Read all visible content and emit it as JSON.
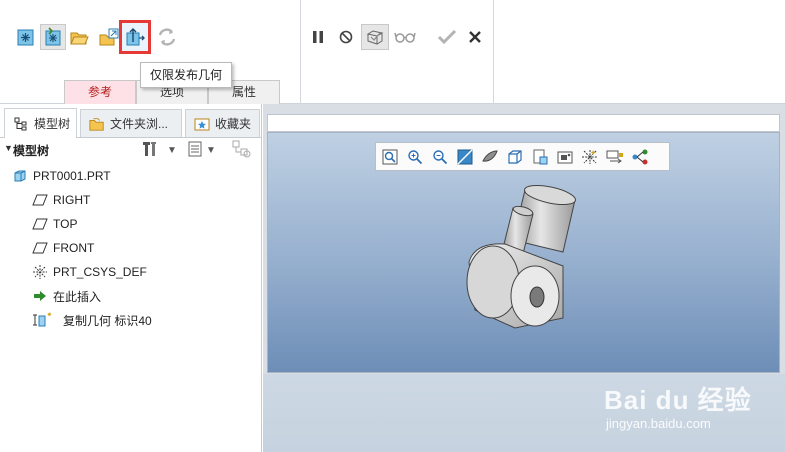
{
  "dashboard": {
    "tooltip": "仅限发布几何",
    "tabs": [
      {
        "label": "参考",
        "active": true
      },
      {
        "label": "选项",
        "active": false
      },
      {
        "label": "属性",
        "active": false
      }
    ],
    "icons": {
      "group1": [
        "csys-icon",
        "import-csys-icon",
        "open-folder-icon",
        "external-ref-icon",
        "publish-geometry-only-icon",
        "update-icon"
      ],
      "group2": [
        "pause-icon",
        "no-preview-icon",
        "verify-icon",
        "glasses-icon",
        "ok-check-icon",
        "cancel-x-icon"
      ]
    },
    "accent": "#e53935"
  },
  "navigator": {
    "tabs": [
      {
        "label": "模型树",
        "icon": "model-tree-icon",
        "active": true
      },
      {
        "label": "文件夹浏...",
        "icon": "folder-browser-icon",
        "active": false
      },
      {
        "label": "收藏夹",
        "icon": "favorites-icon",
        "active": false
      }
    ],
    "tree_header": "模型树",
    "nodes": [
      {
        "label": "PRT0001.PRT",
        "icon": "part-icon"
      },
      {
        "label": "RIGHT",
        "icon": "datum-plane-icon"
      },
      {
        "label": "TOP",
        "icon": "datum-plane-icon"
      },
      {
        "label": "FRONT",
        "icon": "datum-plane-icon"
      },
      {
        "label": "PRT_CSYS_DEF",
        "icon": "csys-icon"
      },
      {
        "label": "在此插入",
        "icon": "insert-here-arrow-icon"
      },
      {
        "label": "复制几何 标识40",
        "icon": "copy-geometry-icon"
      }
    ]
  },
  "graphics": {
    "viewbar_icons": [
      "refit-icon",
      "zoom-in-icon",
      "zoom-out-icon",
      "repaint-icon",
      "display-style-icon",
      "saved-views-icon",
      "view-manager-icon",
      "perspective-icon",
      "datum-display-icon",
      "spin-center-icon",
      "annotation-display-icon",
      "feature-connect-icon"
    ]
  },
  "watermark": {
    "brand": "Bai du 经验",
    "url": "jingyan.baidu.com"
  }
}
